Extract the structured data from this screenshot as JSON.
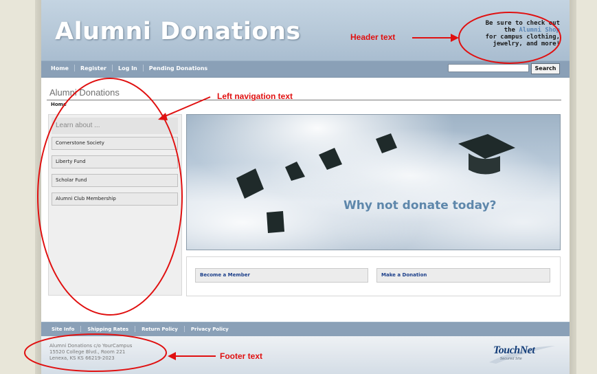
{
  "header": {
    "title": "Alumni Donations",
    "promo_line1": "Be sure to check out",
    "promo_the": "the ",
    "promo_link": "Alumni Shop",
    "promo_line3": "for campus clothing,",
    "promo_line4": "jewelry, and more!"
  },
  "nav": {
    "items": [
      {
        "label": "Home"
      },
      {
        "label": "Register"
      },
      {
        "label": "Log In"
      },
      {
        "label": "Pending Donations"
      }
    ],
    "search_value": "",
    "search_button": "Search"
  },
  "main": {
    "page_title": "Alumni Donations",
    "breadcrumb": "Home",
    "sidebar": {
      "header": "Learn about ...",
      "items": [
        {
          "label": "Cornerstone Society"
        },
        {
          "label": "Liberty Fund"
        },
        {
          "label": "Scholar Fund"
        },
        {
          "label": "Alumni Club Membership"
        }
      ]
    },
    "hero_text": "Why not donate today?",
    "buttons": [
      {
        "label": "Become a Member"
      },
      {
        "label": "Make a Donation"
      }
    ]
  },
  "footer": {
    "links": [
      {
        "label": "Site Info"
      },
      {
        "label": "Shipping Rates"
      },
      {
        "label": "Return Policy"
      },
      {
        "label": "Privacy Policy"
      }
    ],
    "address_line1": "Alumni Donations c/o YourCampus",
    "address_line2": "15520 College Blvd., Room 221",
    "address_line3": "Lenexa, KS KS 66219-2023",
    "logo_text": "TouchNet",
    "logo_sub": "Secured Site"
  },
  "annotations": {
    "header_text": "Header text",
    "left_nav_text": "Left navigation text",
    "footer_text": "Footer text",
    "color": "#e01010"
  },
  "colors": {
    "nav_bar": "#8aa0b7",
    "header_bg": "#b6c8d8",
    "link_blue": "#1c3f8a",
    "hero_text": "#5e87ab"
  }
}
